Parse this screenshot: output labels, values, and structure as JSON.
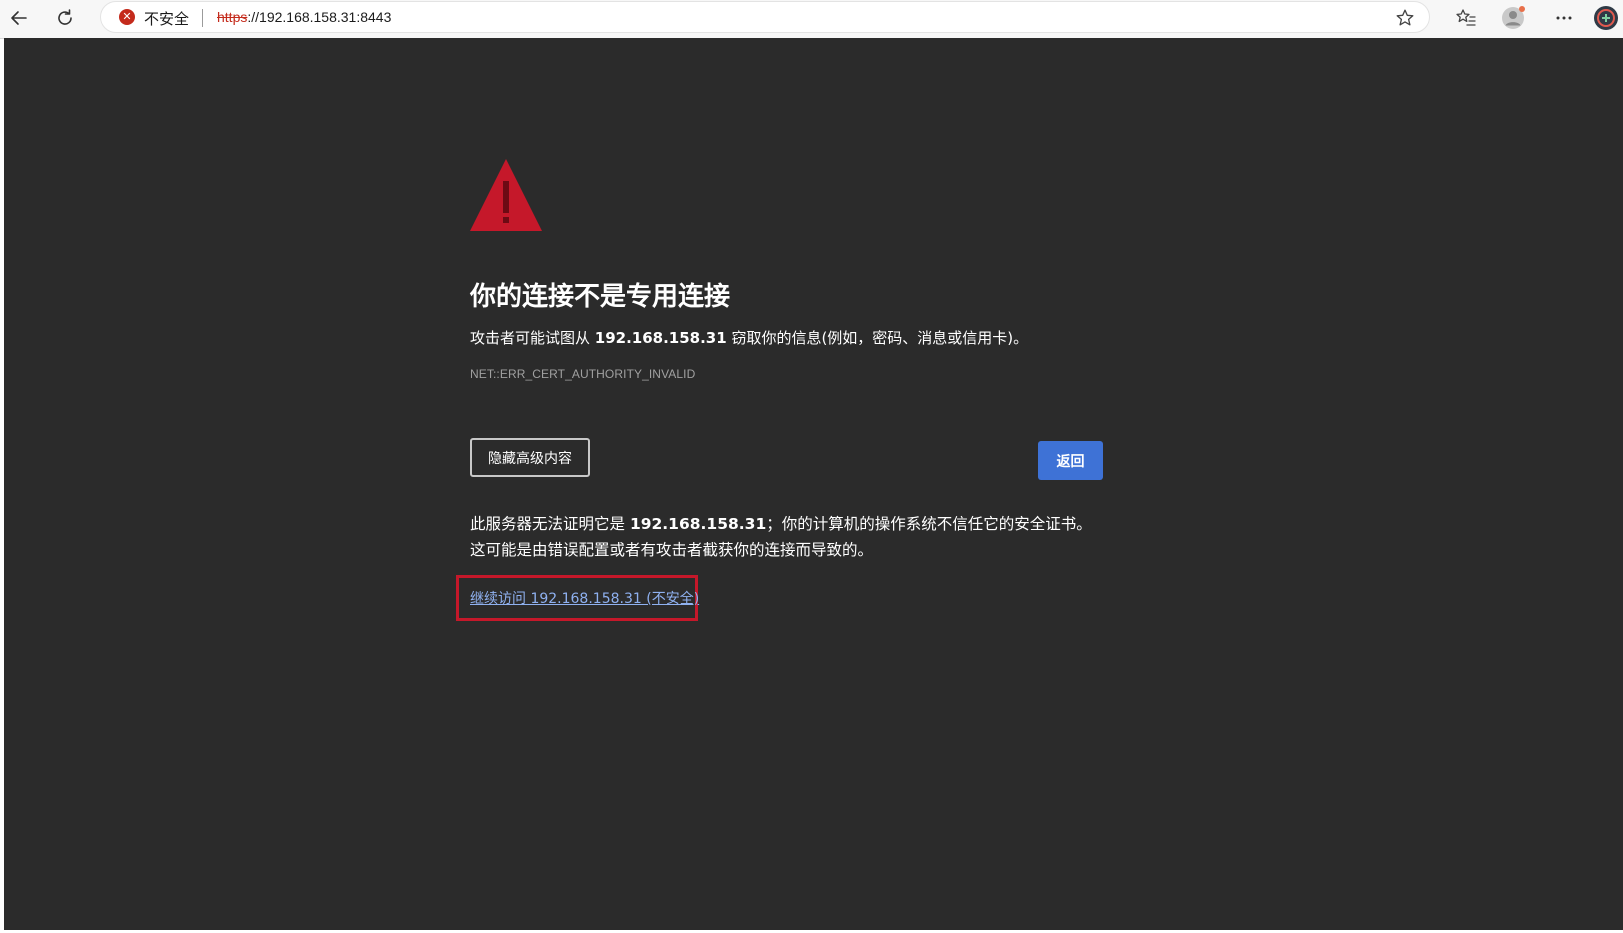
{
  "browser": {
    "security_label": "不安全",
    "url_scheme": "https",
    "url_rest": "://192.168.158.31:8443",
    "icons": {
      "back": "arrow-left-icon",
      "reload": "reload-icon",
      "security": "not-secure-icon",
      "favorite": "star-icon",
      "favorites": "favorites-list-icon",
      "profile": "profile-avatar-icon",
      "menu": "ellipsis-icon",
      "extension": "extension-icon"
    },
    "colors": {
      "not_secure": "#c42b1c"
    }
  },
  "page": {
    "heading": "你的连接不是专用连接",
    "desc_prefix": "攻击者可能试图从 ",
    "desc_host": "192.168.158.31",
    "desc_suffix": " 窃取你的信息(例如，密码、消息或信用卡)。",
    "error_code": "NET::ERR_CERT_AUTHORITY_INVALID",
    "advanced_button": "隐藏高级内容",
    "back_button": "返回",
    "explain_prefix": "此服务器无法证明它是 ",
    "explain_host": "192.168.158.31",
    "explain_suffix": "；你的计算机的操作系统不信任它的安全证书。这可能是由错误配置或者有攻击者截获你的连接而导致的。",
    "proceed_link": "继续访问 192.168.158.31 (不安全)",
    "colors": {
      "background": "#2b2b2b",
      "warning": "#c5182a",
      "primary_button": "#3e72d6",
      "link": "#8fb1f0",
      "highlight_box": "#c5182a"
    }
  }
}
